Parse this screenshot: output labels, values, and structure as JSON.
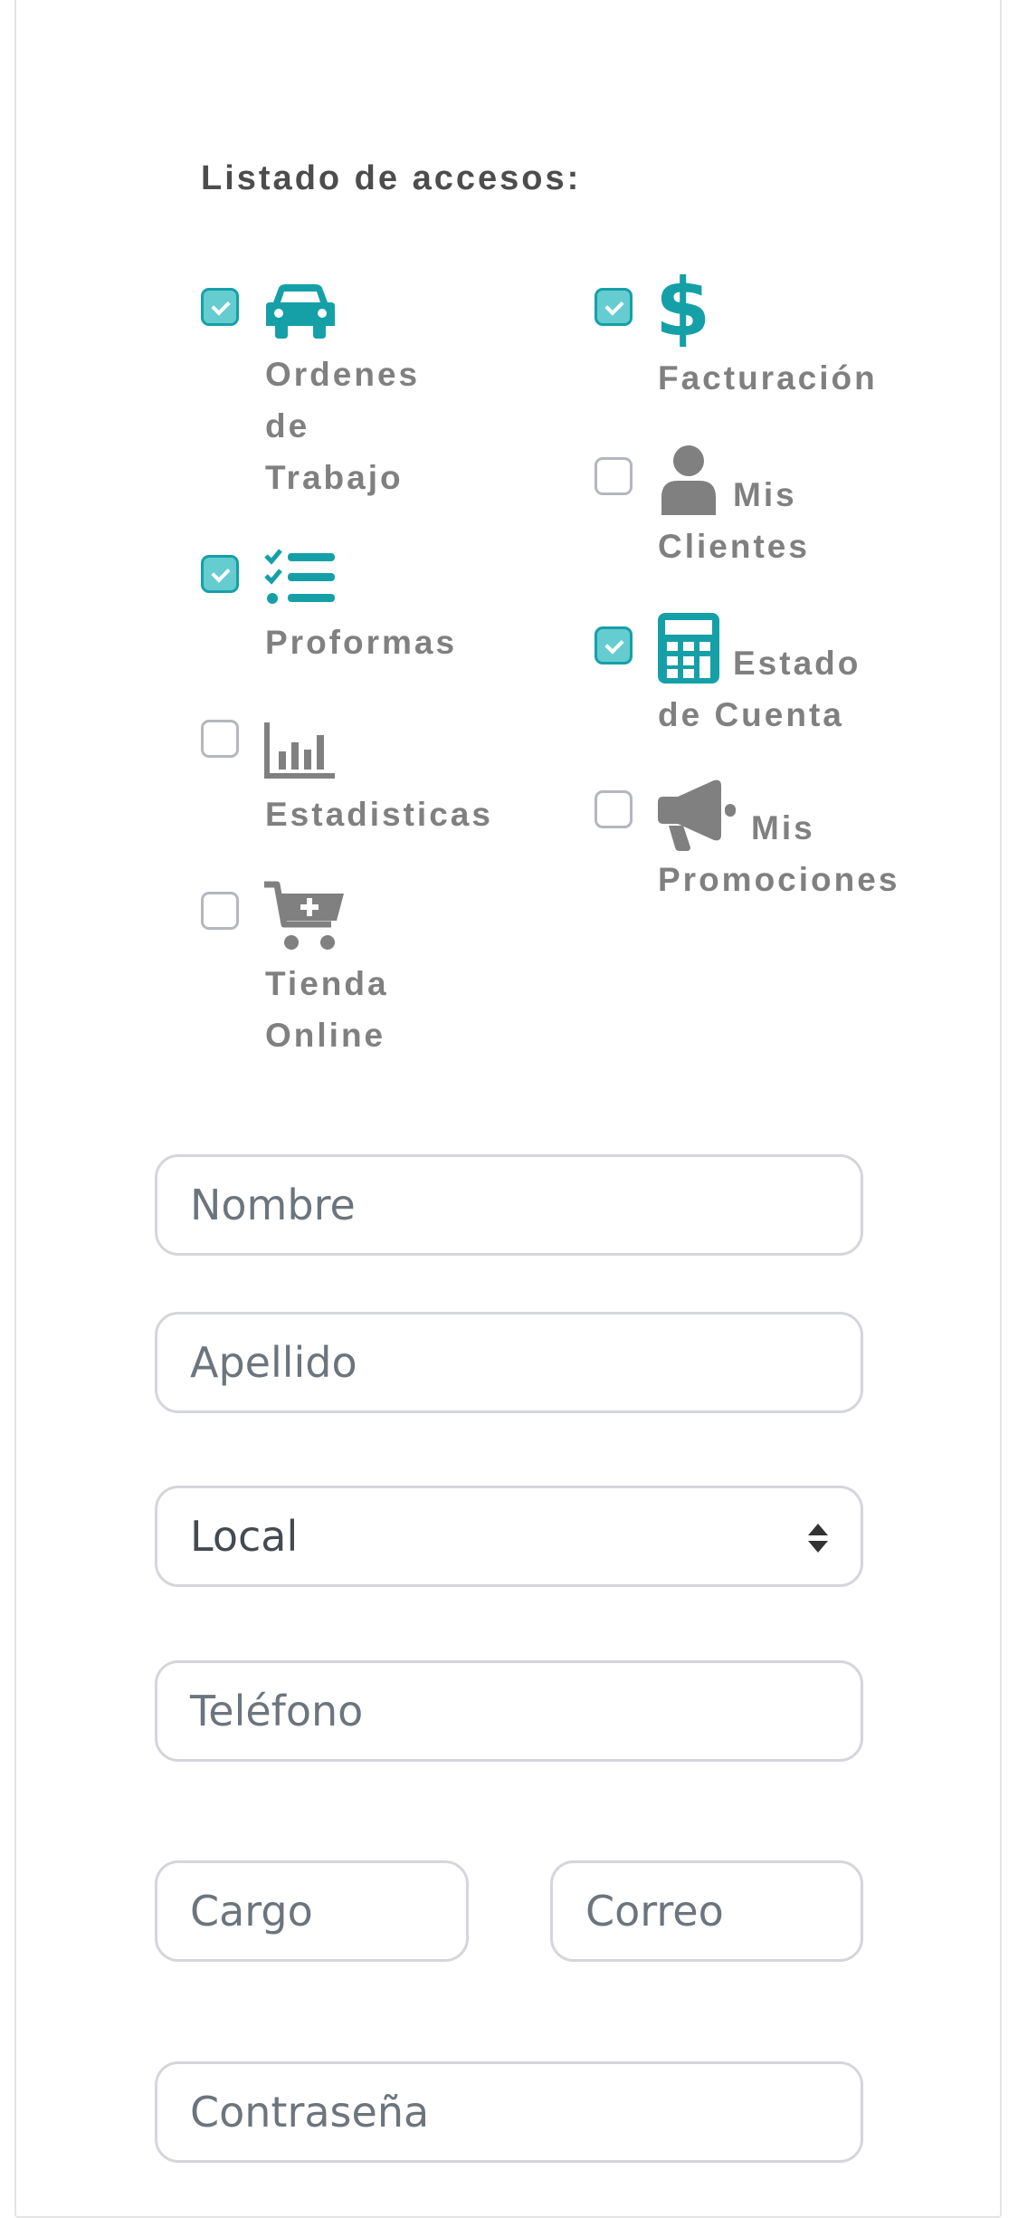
{
  "access_list": {
    "title": "Listado de accesos:",
    "left_items": [
      {
        "checked": true,
        "icon": "car-icon",
        "label_lines": [
          "Ordenes",
          "de",
          "Trabajo"
        ]
      },
      {
        "checked": true,
        "icon": "checklist-icon",
        "label_lines": [
          "Proformas"
        ]
      },
      {
        "checked": false,
        "icon": "bar-chart-icon",
        "label_lines": [
          "Estadisticas"
        ]
      },
      {
        "checked": false,
        "icon": "cart-plus-icon",
        "label_lines": [
          "Tienda",
          "Online"
        ]
      }
    ],
    "right_items": [
      {
        "checked": true,
        "icon": "dollar-icon",
        "label_lines": [
          "Facturación"
        ]
      },
      {
        "checked": false,
        "icon": "user-icon",
        "label_lines": [
          "Mis",
          "Clientes"
        ]
      },
      {
        "checked": true,
        "icon": "calculator-icon",
        "label_lines": [
          "Estado",
          "de Cuenta"
        ]
      },
      {
        "checked": false,
        "icon": "megaphone-icon",
        "label_lines": [
          "Mis",
          "Promociones"
        ]
      }
    ]
  },
  "form": {
    "nombre_placeholder": "Nombre",
    "apellido_placeholder": "Apellido",
    "local_selected": "Local",
    "telefono_placeholder": "Teléfono",
    "cargo_placeholder": "Cargo",
    "correo_placeholder": "Correo",
    "password_placeholder": "Contraseña"
  },
  "colors": {
    "accent": "#15a0a8",
    "checked_fill": "#65ccd0",
    "muted_icon": "#808080",
    "label": "#808080"
  }
}
